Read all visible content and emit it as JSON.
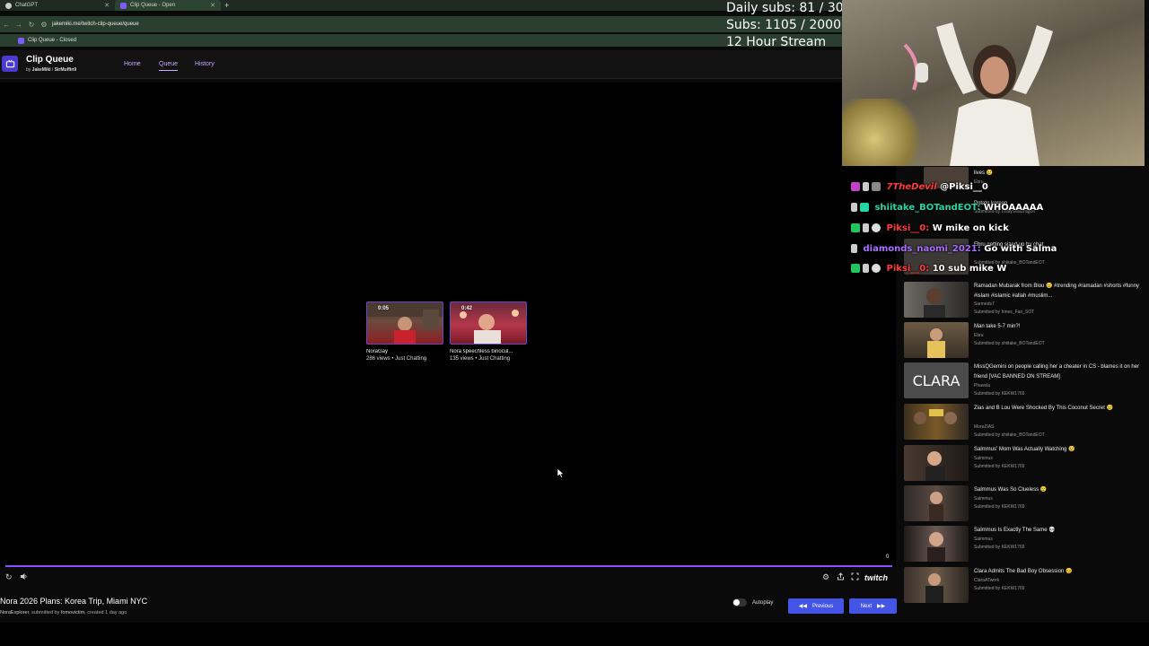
{
  "browser": {
    "tabs": [
      {
        "label": "ChatGPT"
      },
      {
        "label": "Clip Queue - Open"
      }
    ],
    "new_tab": "+",
    "url": "jakemiki.me/twitch-clip-queue/queue",
    "bookmark": "Clip Queue - Closed"
  },
  "app": {
    "title": "Clip Queue",
    "by": "by",
    "author1": "JakeMiki",
    "sep": "/",
    "author2": "SirMuffin9",
    "nav": [
      "Home",
      "Queue",
      "History"
    ]
  },
  "overlay": {
    "line1": "Daily subs: 81 / 30",
    "line2": "Subs: 1105 / 2000",
    "line3": "12 Hour Stream"
  },
  "clips": [
    {
      "duration": "0:05",
      "title": "NoraGay",
      "meta": "286 views • Just Chatting"
    },
    {
      "duration": "0:42",
      "title": "Nora speechless binocul...",
      "meta": "135 views • Just Chatting"
    }
  ],
  "player": {
    "counter": "0",
    "brand": "twitch"
  },
  "current": {
    "title": "Nora 2026 Plans: Korea Trip, Miami NYC",
    "channel": "NoraExplorer",
    "submitted_label": ", submitted by",
    "submitter": "fomovictim",
    "created": ", created 1 day ago"
  },
  "controls": {
    "autoplay": "Autoplay",
    "previous": "Previous",
    "next": "Next"
  },
  "queue": [
    {
      "title": "lives 😢",
      "channel": "Ebru",
      "submitter": ""
    },
    {
      "title": "Potato korean",
      "channel": "",
      "submitter": "Submitted by LeafySeaDrag0n"
    },
    {
      "title": "Ebru getting sized up by chat",
      "channel": "",
      "submitter": "Submitted by shiitake_BOTandEOT"
    },
    {
      "title": "Ramadan Mubarak from Blou 😢 #trending #ramadan #shorts #funny #islam #islamic #allah #muslim...",
      "channel": "Sarmeds7",
      "submitter": "Submitted by Innes_Fan_SOT"
    },
    {
      "title": "Man take 5-7 min?!",
      "channel": "Ebru",
      "submitter": "Submitted by shiitake_BOTandEOT"
    },
    {
      "title": "MissQGemini on people calling her a cheater in CS - blames it on her friend [VAC BANNED ON STREAM]",
      "channel": "Phavela",
      "submitter": "Submitted by KEKW1769",
      "thumb_text": "CLARA"
    },
    {
      "title": "Zias and B Lou Were Shocked By This Coconut Secret 😢",
      "channel": "MoreZIAS",
      "submitter": "Submitted by shiitake_BOTandEOT"
    },
    {
      "title": "Salmmus' Mom Was Actually Watching 😢",
      "channel": "Salmmus",
      "submitter": "Submitted by KEKW1769"
    },
    {
      "title": "Salmmus Was So Clueless 😢",
      "channel": "Salmmus",
      "submitter": "Submitted by KEKW1769"
    },
    {
      "title": "Salmmus Is Exactly The Same 💀",
      "channel": "Salmmus",
      "submitter": "Submitted by KEKW1769"
    },
    {
      "title": "Clara Admits The Bad Boy Obsession 😊",
      "channel": "ClaraATwork",
      "submitter": "Submitted by KEKW1769"
    }
  ],
  "chat": [
    {
      "user": "7TheDevil",
      "message": "@Piksi__0",
      "user_color": "#ff3b3b"
    },
    {
      "user": "shiitake_BOTandEOT:",
      "message": "WHOAAAAA",
      "user_color": "#27d6a6"
    },
    {
      "user": "Piksi__0:",
      "message": "W mike on kick",
      "user_color": "#ff3b3b"
    },
    {
      "user": "diamonds_naomi_2021:",
      "message": "Go with Salma",
      "user_color": "#a970ff"
    },
    {
      "user": "Piksi__0:",
      "message": "10 sub mike W",
      "user_color": "#ff3b3b"
    }
  ],
  "colors": {
    "accent": "#8e4bff",
    "button": "#4455e6",
    "link": "#c6a9ff"
  }
}
